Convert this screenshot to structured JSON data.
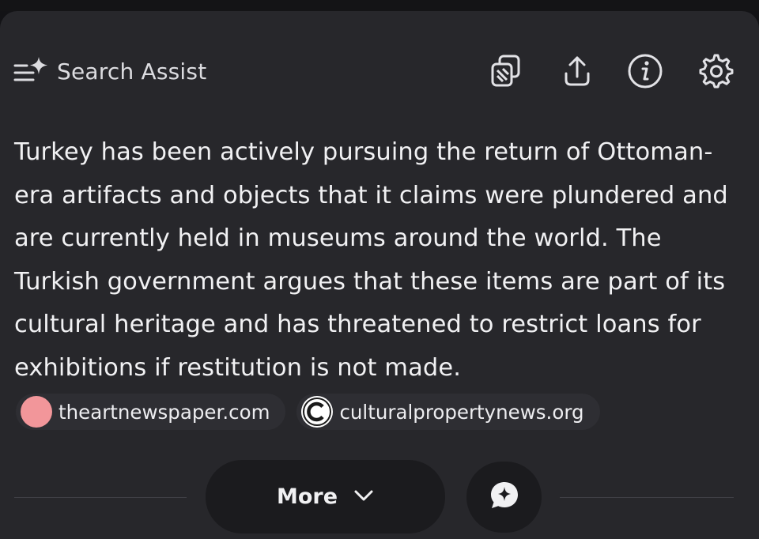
{
  "header": {
    "title": "Search Assist",
    "title_icon": "sparkle-list-icon",
    "actions": [
      {
        "name": "copy",
        "icon": "copy-icon"
      },
      {
        "name": "share",
        "icon": "share-icon"
      },
      {
        "name": "info",
        "icon": "info-icon"
      },
      {
        "name": "settings",
        "icon": "gear-icon"
      }
    ]
  },
  "answer": {
    "text": "Turkey has been actively pursuing the return of Ottoman-era artifacts and objects that it claims were plundered and are currently held in museums around the world. The Turkish government argues that these items are part of its cultural heritage and has threatened to restrict loans for exhibitions if restitution is not made."
  },
  "sources": [
    {
      "label": "theartnewspaper.com",
      "icon": "pink-circle-favicon",
      "color": "#f2969a"
    },
    {
      "label": "culturalpropertynews.org",
      "icon": "c-logo-favicon",
      "color": "#ffffff"
    }
  ],
  "footer": {
    "more_label": "More",
    "more_icon": "chevron-down-icon",
    "chat_icon": "sparkle-chat-icon"
  },
  "colors": {
    "background": "#131316",
    "card": "#27272b",
    "button": "#1b1b1e",
    "text": "#f1f1f3"
  }
}
